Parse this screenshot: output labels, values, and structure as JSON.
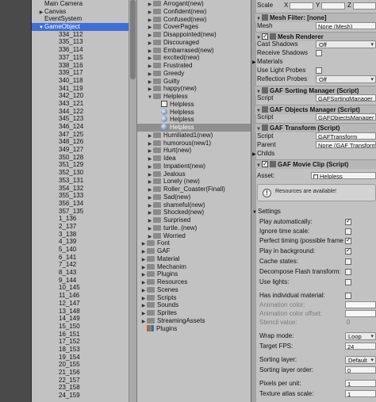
{
  "hierarchy": {
    "items": [
      {
        "label": "Main Camera",
        "arrow": "",
        "indent": 1
      },
      {
        "label": "Canvas",
        "arrow": "▶",
        "indent": 1
      },
      {
        "label": "EventSystem",
        "arrow": "",
        "indent": 1
      },
      {
        "label": "GameObject",
        "arrow": "▼",
        "indent": 1,
        "selected": true
      },
      {
        "label": "334_112",
        "indent": 2
      },
      {
        "label": "335_113",
        "indent": 2
      },
      {
        "label": "336_114",
        "indent": 2
      },
      {
        "label": "337_115",
        "indent": 2
      },
      {
        "label": "338_116",
        "indent": 2
      },
      {
        "label": "339_117",
        "indent": 2
      },
      {
        "label": "340_118",
        "indent": 2
      },
      {
        "label": "341_119",
        "indent": 2
      },
      {
        "label": "342_120",
        "indent": 2
      },
      {
        "label": "343_121",
        "indent": 2
      },
      {
        "label": "344_122",
        "indent": 2
      },
      {
        "label": "345_123",
        "indent": 2
      },
      {
        "label": "346_124",
        "indent": 2
      },
      {
        "label": "347_125",
        "indent": 2
      },
      {
        "label": "348_126",
        "indent": 2
      },
      {
        "label": "349_127",
        "indent": 2
      },
      {
        "label": "350_128",
        "indent": 2
      },
      {
        "label": "351_129",
        "indent": 2
      },
      {
        "label": "352_130",
        "indent": 2
      },
      {
        "label": "353_131",
        "indent": 2
      },
      {
        "label": "354_132",
        "indent": 2
      },
      {
        "label": "355_133",
        "indent": 2
      },
      {
        "label": "356_134",
        "indent": 2
      },
      {
        "label": "357_135",
        "indent": 2
      },
      {
        "label": "1_136",
        "indent": 2
      },
      {
        "label": "2_137",
        "indent": 2
      },
      {
        "label": "3_138",
        "indent": 2
      },
      {
        "label": "4_139",
        "indent": 2
      },
      {
        "label": "5_140",
        "indent": 2
      },
      {
        "label": "6_141",
        "indent": 2
      },
      {
        "label": "7_142",
        "indent": 2
      },
      {
        "label": "8_143",
        "indent": 2
      },
      {
        "label": "9_144",
        "indent": 2
      },
      {
        "label": "10_145",
        "indent": 2
      },
      {
        "label": "11_146",
        "indent": 2
      },
      {
        "label": "12_147",
        "indent": 2
      },
      {
        "label": "13_148",
        "indent": 2
      },
      {
        "label": "14_149",
        "indent": 2
      },
      {
        "label": "15_150",
        "indent": 2
      },
      {
        "label": "16_151",
        "indent": 2
      },
      {
        "label": "17_152",
        "indent": 2
      },
      {
        "label": "18_153",
        "indent": 2
      },
      {
        "label": "19_154",
        "indent": 2
      },
      {
        "label": "20_155",
        "indent": 2
      },
      {
        "label": "21_156",
        "indent": 2
      },
      {
        "label": "22_157",
        "indent": 2
      },
      {
        "label": "23_158",
        "indent": 2
      },
      {
        "label": "24_159",
        "indent": 2
      }
    ]
  },
  "project": {
    "items": [
      {
        "label": "Arrogant(new)",
        "icon": "folder",
        "arrow": "▶",
        "indent": 1
      },
      {
        "label": "Confident(new)",
        "icon": "folder",
        "arrow": "▶",
        "indent": 1
      },
      {
        "label": "Confused(new)",
        "icon": "folder",
        "arrow": "▶",
        "indent": 1
      },
      {
        "label": "CoverPages",
        "icon": "folder",
        "arrow": "▶",
        "indent": 1
      },
      {
        "label": "Disappointed(new)",
        "icon": "folder",
        "arrow": "▶",
        "indent": 1
      },
      {
        "label": "Discouraged",
        "icon": "folder",
        "arrow": "▶",
        "indent": 1
      },
      {
        "label": "Embarrased(new)",
        "icon": "folder",
        "arrow": "▶",
        "indent": 1
      },
      {
        "label": "excited(new)",
        "icon": "folder",
        "arrow": "▶",
        "indent": 1
      },
      {
        "label": "Frustrated",
        "icon": "folder",
        "arrow": "▶",
        "indent": 1
      },
      {
        "label": "Greedy",
        "icon": "folder",
        "arrow": "▶",
        "indent": 1
      },
      {
        "label": "Guilty",
        "icon": "folder",
        "arrow": "▶",
        "indent": 1
      },
      {
        "label": "happy(new)",
        "icon": "folder",
        "arrow": "▶",
        "indent": 1
      },
      {
        "label": "Helpless",
        "icon": "folder",
        "arrow": "▼",
        "indent": 1
      },
      {
        "label": "Helpless",
        "icon": "gaf",
        "arrow": "",
        "indent": 2
      },
      {
        "label": "Helpless",
        "icon": "sphere",
        "arrow": "",
        "indent": 2
      },
      {
        "label": "Helpless",
        "icon": "sphere",
        "arrow": "",
        "indent": 2
      },
      {
        "label": "Helpless",
        "icon": "sphere",
        "arrow": "",
        "indent": 2,
        "selected": true
      },
      {
        "label": "Humiliated1(new)",
        "icon": "folder",
        "arrow": "▶",
        "indent": 1
      },
      {
        "label": "humorous(new1)",
        "icon": "folder",
        "arrow": "▶",
        "indent": 1
      },
      {
        "label": "Hurt(new)",
        "icon": "folder",
        "arrow": "▶",
        "indent": 1
      },
      {
        "label": "Idea",
        "icon": "folder",
        "arrow": "▶",
        "indent": 1
      },
      {
        "label": "Impatient(new)",
        "icon": "folder",
        "arrow": "▶",
        "indent": 1
      },
      {
        "label": "Jealous",
        "icon": "folder",
        "arrow": "▶",
        "indent": 1
      },
      {
        "label": "Lonely (new)",
        "icon": "folder",
        "arrow": "▶",
        "indent": 1
      },
      {
        "label": "Roller_Coaster(Finall)",
        "icon": "folder",
        "arrow": "▶",
        "indent": 1
      },
      {
        "label": "Sad(new)",
        "icon": "folder",
        "arrow": "▶",
        "indent": 1
      },
      {
        "label": "shameful(new)",
        "icon": "folder",
        "arrow": "▶",
        "indent": 1
      },
      {
        "label": "Shocked(new)",
        "icon": "folder",
        "arrow": "▶",
        "indent": 1
      },
      {
        "label": "Surprised",
        "icon": "folder",
        "arrow": "▶",
        "indent": 1
      },
      {
        "label": "turtle..(new)",
        "icon": "folder",
        "arrow": "▶",
        "indent": 1
      },
      {
        "label": "Worried",
        "icon": "folder",
        "arrow": "▶",
        "indent": 1
      },
      {
        "label": "Font",
        "icon": "folder",
        "arrow": "▶",
        "indent": 0
      },
      {
        "label": "GAF",
        "icon": "folder",
        "arrow": "▶",
        "indent": 0
      },
      {
        "label": "Material",
        "icon": "folder",
        "arrow": "▶",
        "indent": 0
      },
      {
        "label": "Mechanim",
        "icon": "folder",
        "arrow": "▶",
        "indent": 0
      },
      {
        "label": "Plugins",
        "icon": "folder",
        "arrow": "▶",
        "indent": 0
      },
      {
        "label": "Resources",
        "icon": "folder",
        "arrow": "▶",
        "indent": 0
      },
      {
        "label": "Scenes",
        "icon": "folder",
        "arrow": "▶",
        "indent": 0
      },
      {
        "label": "Scripts",
        "icon": "folder",
        "arrow": "▶",
        "indent": 0
      },
      {
        "label": "Sounds",
        "icon": "folder",
        "arrow": "▶",
        "indent": 0
      },
      {
        "label": "Sprites",
        "icon": "folder",
        "arrow": "▶",
        "indent": 0
      },
      {
        "label": "StreamingAssets",
        "icon": "folder",
        "arrow": "▶",
        "indent": 0
      },
      {
        "label": "Plugins",
        "icon": "plug",
        "arrow": "",
        "indent": 0
      }
    ]
  },
  "inspector": {
    "top": {
      "scale_label": "Scale",
      "x": "X",
      "y": "Y",
      "z": "Z"
    },
    "mesh_filter": {
      "title": "Mesh Filter: [none]",
      "mesh_label": "Mesh",
      "mesh_value": "None (Mesh)"
    },
    "mesh_renderer": {
      "title": "Mesh Renderer",
      "cast_shadows_label": "Cast Shadows",
      "cast_shadows_value": "Off",
      "receive_shadows_label": "Receive Shadows",
      "materials_label": "Materials",
      "use_light_probes_label": "Use Light Probes",
      "reflection_probes_label": "Reflection Probes",
      "reflection_probes_value": "Off"
    },
    "gaf_sorting": {
      "title": "GAF Sorting Manager (Script)",
      "script_label": "Script",
      "script_value": "GAFSortingManager"
    },
    "gaf_objects": {
      "title": "GAF Objects Manager (Script)",
      "script_label": "Script",
      "script_value": "GAFObjectsManager"
    },
    "gaf_transform": {
      "title": "GAF Transform (Script)",
      "script_label": "Script",
      "script_value": "GAFTransform",
      "parent_label": "Parent",
      "parent_value": "None (GAF Transform)",
      "childs_label": "Childs"
    },
    "gaf_movie": {
      "title": "GAF Movie Clip (Script)",
      "asset_label": "Asset:",
      "asset_value": "Helpless",
      "info_text": "Resources are available!"
    },
    "settings": {
      "title": "Settings",
      "play_automatically": "Play automatically:",
      "ignore_time_scale": "Ignore time scale:",
      "perfect_timing": "Perfect timing (possible frame",
      "play_in_background": "Play in background:",
      "cache_states": "Cache states:",
      "decompose_flash": "Decompose Flash transform:",
      "use_lights": "Use lights:",
      "has_individual_material": "Has individual material:",
      "animation_color": "Animation color:",
      "animation_color_offset": "Animation color offset:",
      "stencil_value": "Stencil value:",
      "stencil_number": "0",
      "wrap_mode_label": "Wrap mode:",
      "wrap_mode_value": "Loop",
      "target_fps_label": "Target FPS:",
      "target_fps_value": "24",
      "sorting_layer_label": "Sorting layer:",
      "sorting_layer_value": "Default",
      "sorting_order_label": "Sorting layer order:",
      "sorting_order_value": "0",
      "pixels_per_unit_label": "Pixels per unit:",
      "pixels_per_unit_value": "1",
      "texture_atlas_label": "Texture atlas scale:",
      "texture_atlas_value": "1"
    }
  }
}
